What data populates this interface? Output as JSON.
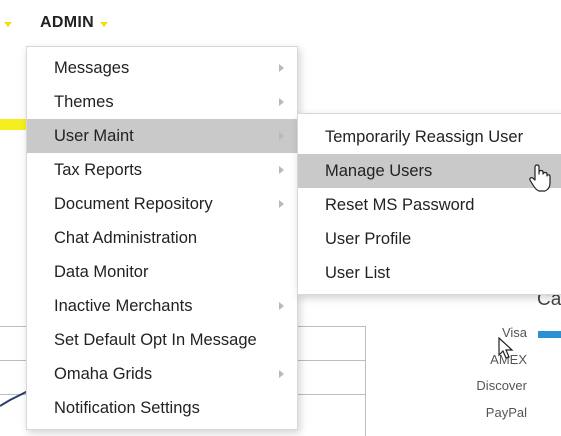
{
  "nav": {
    "admin_label": "ADMIN"
  },
  "main_menu": {
    "items": [
      {
        "label": "Messages",
        "submenu": true
      },
      {
        "label": "Themes",
        "submenu": true
      },
      {
        "label": "User Maint",
        "submenu": true,
        "highlighted": true
      },
      {
        "label": "Tax Reports",
        "submenu": true
      },
      {
        "label": "Document Repository",
        "submenu": true
      },
      {
        "label": "Chat Administration",
        "submenu": false
      },
      {
        "label": "Data Monitor",
        "submenu": false
      },
      {
        "label": "Inactive Merchants",
        "submenu": true
      },
      {
        "label": "Set Default Opt In Message",
        "submenu": false
      },
      {
        "label": "Omaha Grids",
        "submenu": true
      },
      {
        "label": "Notification Settings",
        "submenu": false
      }
    ]
  },
  "user_maint_submenu": {
    "items": [
      {
        "label": "Temporarily Reassign User"
      },
      {
        "label": "Manage Users",
        "highlighted": true
      },
      {
        "label": "Reset MS Password"
      },
      {
        "label": "User Profile"
      },
      {
        "label": "User List"
      }
    ]
  },
  "background": {
    "caption_fragment": "Ca",
    "legend": [
      "Visa",
      "AMEX",
      "Discover",
      "PayPal"
    ]
  },
  "colors": {
    "accent_yellow": "#f2e200",
    "highlight_gray": "#c9c9c9",
    "legend_blue": "#2d8fd4"
  },
  "icons": {
    "caret": "caret-down-icon",
    "submenu_arrow": "chevron-right-icon",
    "cursor": "hand-pointer-cursor"
  }
}
